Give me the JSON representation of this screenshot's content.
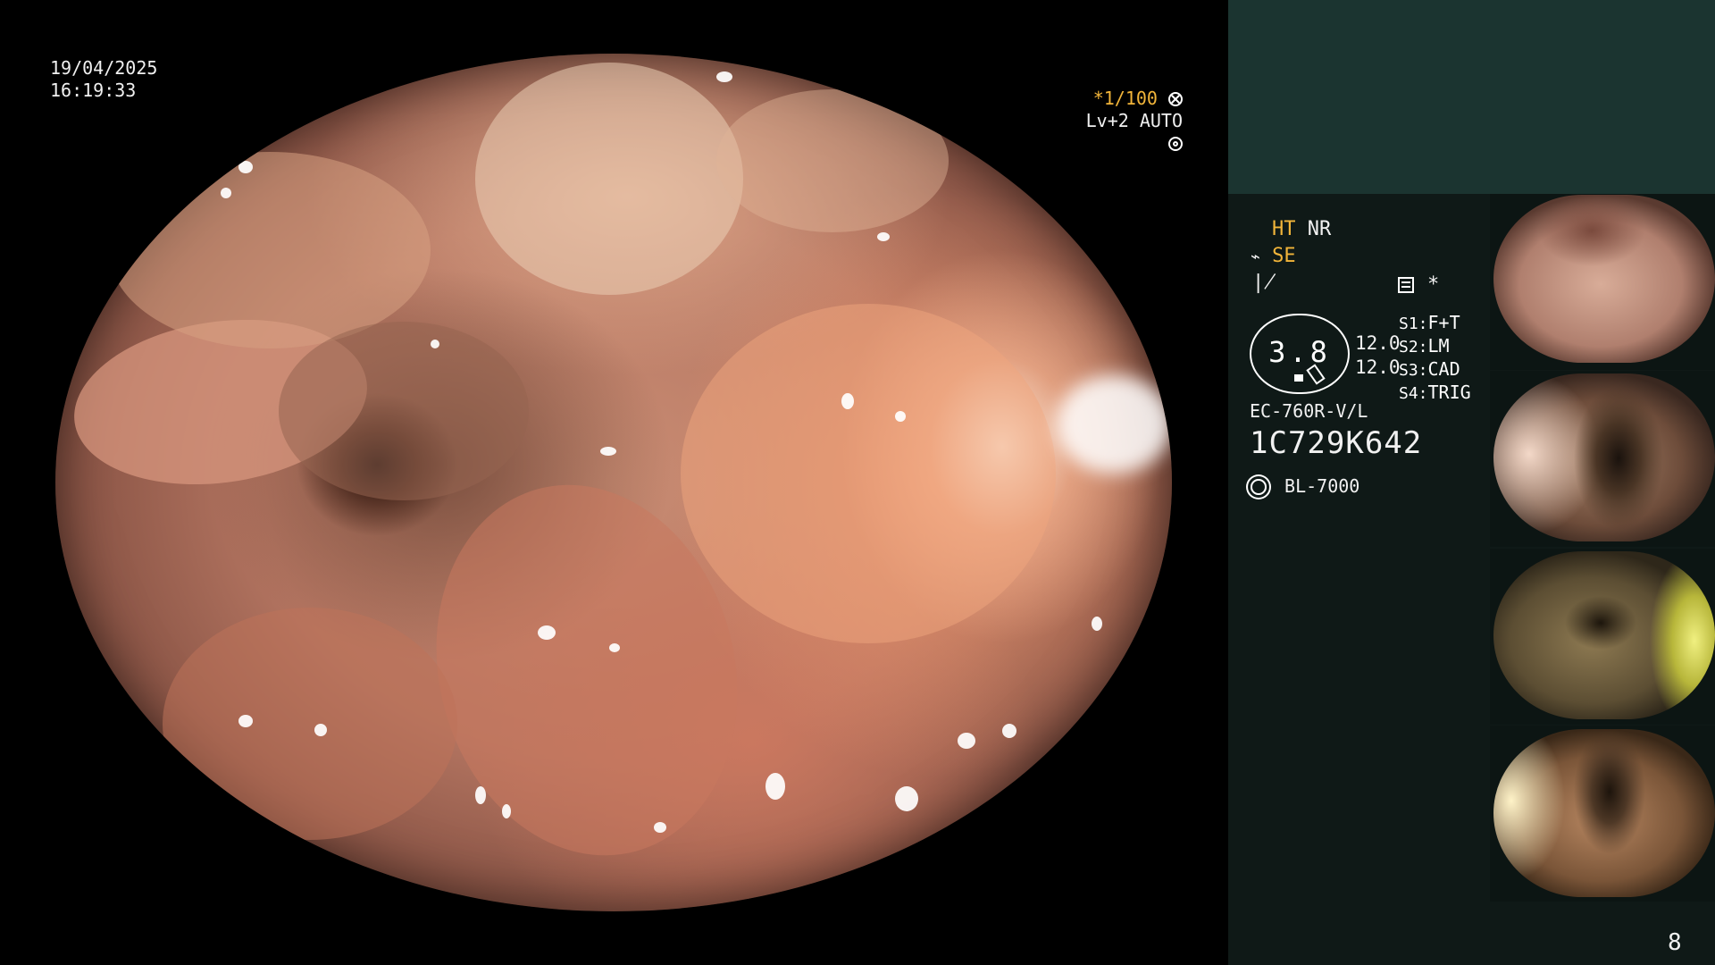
{
  "header": {
    "date": "19/04/2025",
    "time": "16:19:33",
    "shutter": "*1/100",
    "level": "Lv+2",
    "iris": "AUTO"
  },
  "panel": {
    "mode_ht": "HT",
    "mode_nr": "NR",
    "mode_se": "SE",
    "zoom_value": "3.8",
    "gain_1": "12.0",
    "gain_2": "12.0",
    "switches": [
      {
        "key": "S1:",
        "value": "F+T"
      },
      {
        "key": "S2:",
        "value": "LM"
      },
      {
        "key": "S3:",
        "value": "CAD"
      },
      {
        "key": "S4:",
        "value": "TRIG"
      }
    ],
    "asterisk": "*",
    "scope_model": "EC-760R-V/L",
    "serial": "1C729K642",
    "light_source": "BL-7000",
    "capture_count": "8"
  },
  "thumbnails": [
    {
      "name": "capture-1",
      "tone": "pink"
    },
    {
      "name": "capture-2",
      "tone": "dark-lumen"
    },
    {
      "name": "capture-3",
      "tone": "olive"
    },
    {
      "name": "capture-4",
      "tone": "dark-lumen-bright"
    }
  ],
  "icons": {
    "shutter_icon": "aperture-icon",
    "iris_icon": "iris-icon",
    "se_icon": "structure-enhance-icon",
    "color_icon": "color-mode-icon",
    "freeze_icon": "freeze-memory-icon",
    "light_icon": "light-source-icon"
  },
  "colors": {
    "accent_yellow": "#f2b53a",
    "panel_bg": "#0f1917",
    "panel_top": "#1b3430"
  }
}
